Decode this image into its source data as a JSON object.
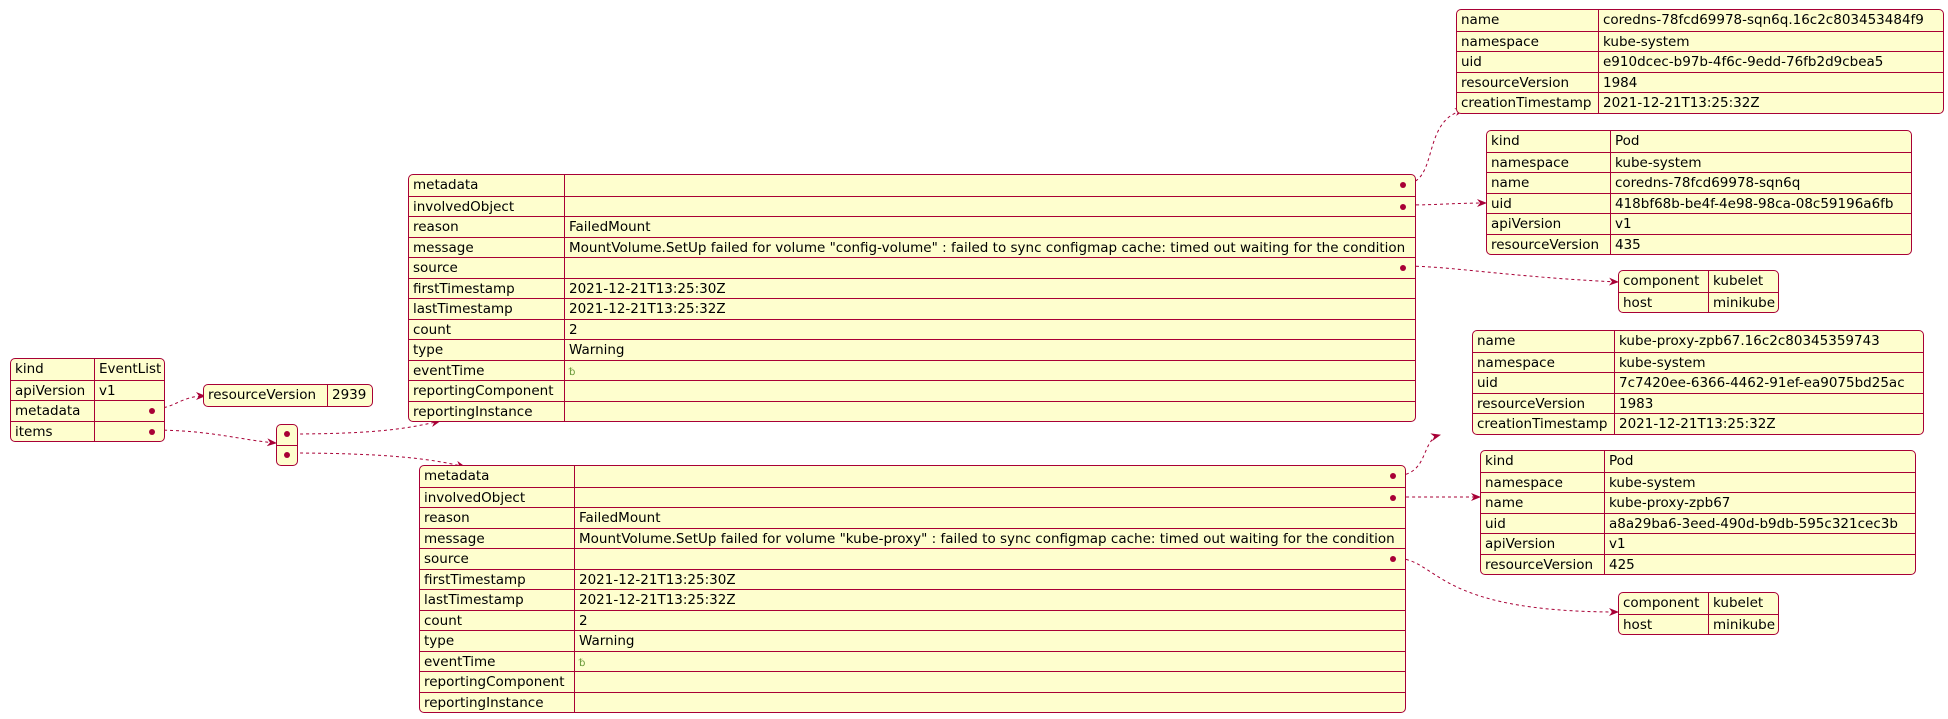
{
  "root": {
    "rows": [
      {
        "key": "kind",
        "value": "EventList"
      },
      {
        "key": "apiVersion",
        "value": "v1"
      },
      {
        "key": "metadata",
        "value": ""
      },
      {
        "key": "items",
        "value": ""
      }
    ],
    "metadata": {
      "key": "resourceVersion",
      "value": "2939"
    }
  },
  "items": [
    {
      "rows": [
        {
          "key": "metadata",
          "value": ""
        },
        {
          "key": "involvedObject",
          "value": ""
        },
        {
          "key": "reason",
          "value": "FailedMount"
        },
        {
          "key": "message",
          "value": "MountVolume.SetUp failed for volume \"config-volume\" : failed to sync configmap cache: timed out waiting for the condition"
        },
        {
          "key": "source",
          "value": ""
        },
        {
          "key": "firstTimestamp",
          "value": "2021-12-21T13:25:30Z"
        },
        {
          "key": "lastTimestamp",
          "value": "2021-12-21T13:25:32Z"
        },
        {
          "key": "count",
          "value": "2"
        },
        {
          "key": "type",
          "value": "Warning"
        },
        {
          "key": "eventTime",
          "value": ""
        },
        {
          "key": "reportingComponent",
          "value": ""
        },
        {
          "key": "reportingInstance",
          "value": ""
        }
      ],
      "metadata": [
        {
          "key": "name",
          "value": "coredns-78fcd69978-sqn6q.16c2c803453484f9"
        },
        {
          "key": "namespace",
          "value": "kube-system"
        },
        {
          "key": "uid",
          "value": "e910dcec-b97b-4f6c-9edd-76fb2d9cbea5"
        },
        {
          "key": "resourceVersion",
          "value": "1984"
        },
        {
          "key": "creationTimestamp",
          "value": "2021-12-21T13:25:32Z"
        }
      ],
      "involvedObject": [
        {
          "key": "kind",
          "value": "Pod"
        },
        {
          "key": "namespace",
          "value": "kube-system"
        },
        {
          "key": "name",
          "value": "coredns-78fcd69978-sqn6q"
        },
        {
          "key": "uid",
          "value": "418bf68b-be4f-4e98-98ca-08c59196a6fb"
        },
        {
          "key": "apiVersion",
          "value": "v1"
        },
        {
          "key": "resourceVersion",
          "value": "435"
        }
      ],
      "source": [
        {
          "key": "component",
          "value": "kubelet"
        },
        {
          "key": "host",
          "value": "minikube"
        }
      ]
    },
    {
      "rows": [
        {
          "key": "metadata",
          "value": ""
        },
        {
          "key": "involvedObject",
          "value": ""
        },
        {
          "key": "reason",
          "value": "FailedMount"
        },
        {
          "key": "message",
          "value": "MountVolume.SetUp failed for volume \"kube-proxy\" : failed to sync configmap cache: timed out waiting for the condition"
        },
        {
          "key": "source",
          "value": ""
        },
        {
          "key": "firstTimestamp",
          "value": "2021-12-21T13:25:30Z"
        },
        {
          "key": "lastTimestamp",
          "value": "2021-12-21T13:25:32Z"
        },
        {
          "key": "count",
          "value": "2"
        },
        {
          "key": "type",
          "value": "Warning"
        },
        {
          "key": "eventTime",
          "value": ""
        },
        {
          "key": "reportingComponent",
          "value": ""
        },
        {
          "key": "reportingInstance",
          "value": ""
        }
      ],
      "metadata": [
        {
          "key": "name",
          "value": "kube-proxy-zpb67.16c2c80345359743"
        },
        {
          "key": "namespace",
          "value": "kube-system"
        },
        {
          "key": "uid",
          "value": "7c7420ee-6366-4462-91ef-ea9075bd25ac"
        },
        {
          "key": "resourceVersion",
          "value": "1983"
        },
        {
          "key": "creationTimestamp",
          "value": "2021-12-21T13:25:32Z"
        }
      ],
      "involvedObject": [
        {
          "key": "kind",
          "value": "Pod"
        },
        {
          "key": "namespace",
          "value": "kube-system"
        },
        {
          "key": "name",
          "value": "kube-proxy-zpb67"
        },
        {
          "key": "uid",
          "value": "a8a29ba6-3eed-490d-b9db-595c321cec3b"
        },
        {
          "key": "apiVersion",
          "value": "v1"
        },
        {
          "key": "resourceVersion",
          "value": "425"
        }
      ],
      "source": [
        {
          "key": "component",
          "value": "kubelet"
        },
        {
          "key": "host",
          "value": "minikube"
        }
      ]
    }
  ],
  "style": {
    "border_color": "#a80036",
    "fill_color": "#fefece",
    "null_icon": "null-value-icon"
  }
}
